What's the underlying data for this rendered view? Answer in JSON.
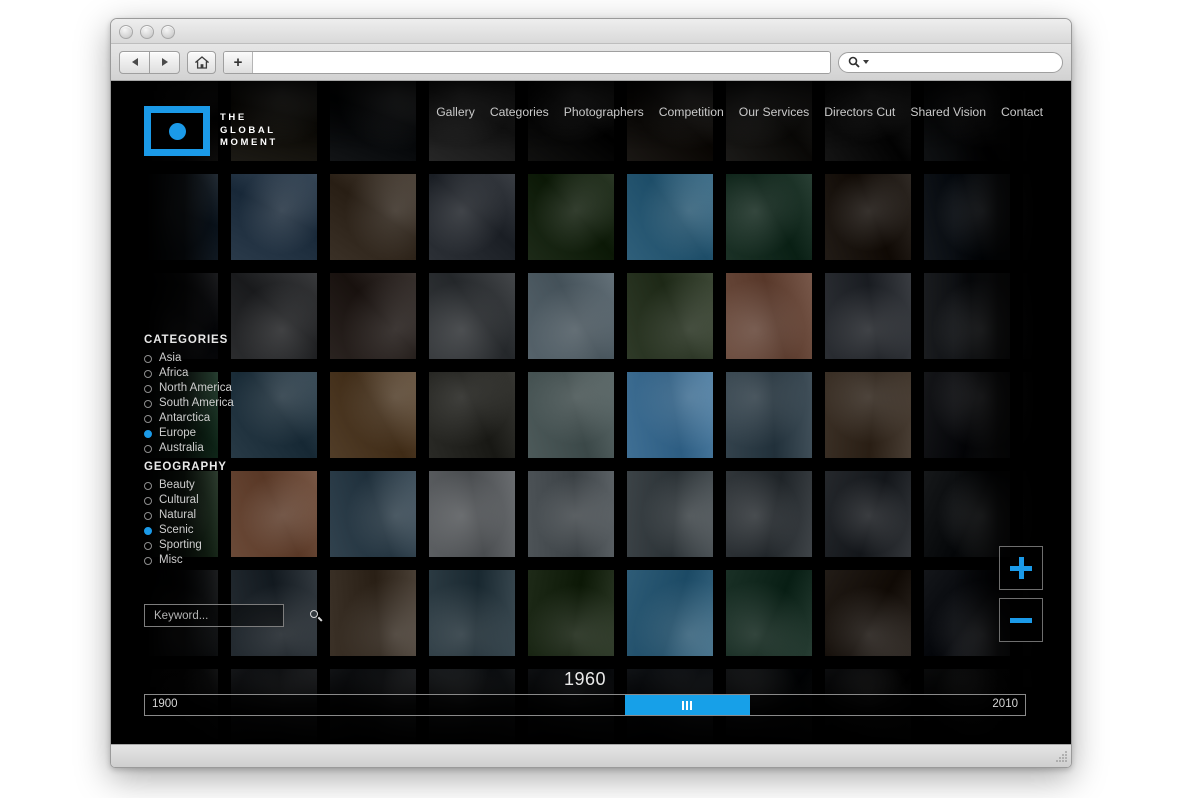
{
  "browser": {
    "back_label": "Back",
    "forward_label": "Forward",
    "home_icon": "home-icon",
    "new_tab_label": "+",
    "address_value": "",
    "address_placeholder": "",
    "search_placeholder": "",
    "search_value": "",
    "search_icon": "search-icon"
  },
  "site": {
    "logo": {
      "line1": "THE",
      "line2": "GLOBAL",
      "line3": "MOMENT"
    },
    "nav": [
      {
        "label": "Gallery"
      },
      {
        "label": "Categories"
      },
      {
        "label": "Photographers"
      },
      {
        "label": "Competition"
      },
      {
        "label": "Our Services"
      },
      {
        "label": "Directors Cut"
      },
      {
        "label": "Shared Vision"
      },
      {
        "label": "Contact"
      }
    ],
    "categories": {
      "title": "CATEGORIES",
      "options": [
        {
          "label": "Asia",
          "selected": false
        },
        {
          "label": "Africa",
          "selected": false
        },
        {
          "label": "North America",
          "selected": false
        },
        {
          "label": "South America",
          "selected": false
        },
        {
          "label": "Antarctica",
          "selected": false
        },
        {
          "label": "Europe",
          "selected": true
        },
        {
          "label": "Australia",
          "selected": false
        }
      ]
    },
    "geography": {
      "title": "GEOGRAPHY",
      "options": [
        {
          "label": "Beauty",
          "selected": false
        },
        {
          "label": "Cultural",
          "selected": false
        },
        {
          "label": "Natural",
          "selected": false
        },
        {
          "label": "Scenic",
          "selected": true
        },
        {
          "label": "Sporting",
          "selected": false
        },
        {
          "label": "Misc",
          "selected": false
        }
      ]
    },
    "keyword": {
      "value": "",
      "placeholder": "Keyword...",
      "icon": "search-icon"
    },
    "zoom_controls": {
      "zoom_in_label": "+",
      "zoom_out_label": "–"
    },
    "timeline": {
      "current_year": "1960",
      "min_year": "1900",
      "max_year": "2010",
      "handle_position_percent": 54.5
    },
    "accent_color": "#1b9ae8",
    "background_color": "#000000"
  },
  "gallery": {
    "columns": 12,
    "rows": 7,
    "tiles": [
      "#0b0c0d",
      "#141312",
      "#1c1a15",
      "#121416",
      "#262626",
      "#10100f",
      "#1a1714",
      "#1b1a18",
      "#141414",
      "#0f1113",
      "#0d0d0e",
      "#090909",
      "#0a0a0b",
      "#1d2833",
      "#2a3a4a",
      "#3a3026",
      "#2c3036",
      "#1d2a18",
      "#2f5f7a",
      "#1b3126",
      "#211b16",
      "#13171c",
      "#0e0f10",
      "#0a0a0a",
      "#0b0b0c",
      "#141518",
      "#2b2c2e",
      "#2a2320",
      "#36393c",
      "#56636b",
      "#2f3a28",
      "#6a4a3c",
      "#2b2e33",
      "#1a1c1f",
      "#0d0e0f",
      "#090909",
      "#0a0a0b",
      "#23402f",
      "#283a46",
      "#513d28",
      "#2a2a26",
      "#4d5a5a",
      "#3f6f94",
      "#33424c",
      "#3b3026",
      "#151619",
      "#0d0d0e",
      "#090909",
      "#0a0a0a",
      "#2a3d2c",
      "#6b4a38",
      "#31424e",
      "#5c5f62",
      "#4d5357",
      "#3c4347",
      "#31363a",
      "#25282c",
      "#16181a",
      "#0c0c0d",
      "#090909",
      "#0a0a0a",
      "#151719",
      "#242b31",
      "#3b3127",
      "#2b3a42",
      "#1e2a18",
      "#2e5c77",
      "#1a3026",
      "#221c17",
      "#14161a",
      "#0c0c0d",
      "#090909",
      "#090909",
      "#101112",
      "#1a1c1f",
      "#16181b",
      "#1c1f22",
      "#121417",
      "#15181c",
      "#121416",
      "#0f1012",
      "#0c0d0e",
      "#0a0a0b",
      "#080808"
    ]
  }
}
